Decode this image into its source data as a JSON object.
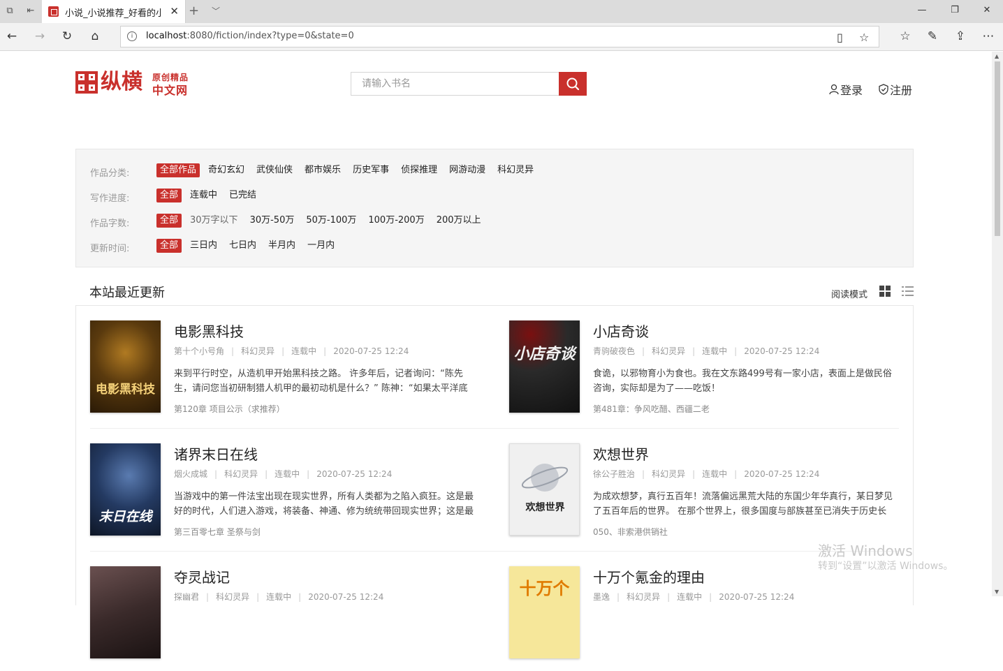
{
  "browser": {
    "tab_title": "小说_小说推荐_好看的小说",
    "url_host": "localhost",
    "url_rest": ":8080/fiction/index?type=0&state=0"
  },
  "site": {
    "logo_main": "纵横",
    "logo_sub1": "原创精品",
    "logo_sub2": "中文网",
    "search_placeholder": "请输入书名",
    "login": "登录",
    "register": "注册"
  },
  "filters": [
    {
      "label": "作品分类:",
      "options": [
        "全部作品",
        "奇幻玄幻",
        "武侠仙侠",
        "都市娱乐",
        "历史军事",
        "侦探推理",
        "网游动漫",
        "科幻灵异"
      ],
      "active": 0
    },
    {
      "label": "写作进度:",
      "options": [
        "全部",
        "连载中",
        "已完结"
      ],
      "active": 0
    },
    {
      "label": "作品字数:",
      "options": [
        "全部",
        "30万字以下",
        "30万-50万",
        "50万-100万",
        "100万-200万",
        "200万以上"
      ],
      "active": 0
    },
    {
      "label": "更新时间:",
      "options": [
        "全部",
        "三日内",
        "七日内",
        "半月内",
        "一月内"
      ],
      "active": 0
    }
  ],
  "section": {
    "title": "本站最近更新",
    "mode_label": "阅读模式"
  },
  "books": [
    {
      "name": "电影黑科技",
      "author": "第十个小号角",
      "category": "科幻灵异",
      "status": "连载中",
      "time": "2020-07-25 12:24",
      "desc": "来到平行时空，从造机甲开始黑科技之路。 许多年后，记者询问：“陈先生，请问您当初研制猎人机甲的最初动机是什么？” 陈神：“如果太平洋底下有一个怪兽...",
      "latest": "第120章 项目公示（求推荐）",
      "cover_text": "电影黑科技",
      "cover_bg": "#3a2608",
      "cover_fg": "#f0c35a"
    },
    {
      "name": "小店奇谈",
      "author": "青驹破夜色",
      "category": "科幻灵异",
      "status": "连载中",
      "time": "2020-07-25 12:24",
      "desc": "食诡，以邪物育小为食也。我在文东路499号有一家小店，表面上是做民俗咨询，实际却是为了——吃饭！",
      "latest": "第481章：争风吃醋、西疆二老",
      "cover_text": "小店奇谈",
      "cover_bg": "#1a1a1a",
      "cover_fg": "#f2f2f2"
    },
    {
      "name": "诸界末日在线",
      "author": "烟火成城",
      "category": "科幻灵异",
      "status": "连载中",
      "time": "2020-07-25 12:24",
      "desc": "当游戏中的第一件法宝出现在现实世界，所有人类都为之陷入疯狂。这是最好的时代，人们进入游戏，将装备、神通、修为统统带回现实世界；这是最坏的时代...",
      "latest": "第三百零七章 圣祭与剑",
      "cover_text": "末日在线",
      "cover_bg": "#14243d",
      "cover_fg": "#ffffff"
    },
    {
      "name": "欢想世界",
      "author": "徐公子胜治",
      "category": "科幻灵异",
      "status": "连载中",
      "time": "2020-07-25 12:24",
      "desc": "为成欢想梦，真行五百年！流落偏远黑荒大陆的东国少年华真行，某日梦见了五百年后的世界。 在那个世界上，很多国度与部族甚至已消失于历史长河...",
      "latest": "050、非索港供销社",
      "cover_text": "欢想世界",
      "cover_bg": "#eeeeee",
      "cover_fg": "#222222"
    },
    {
      "name": "夺灵战记",
      "author": "探幽君",
      "category": "科幻灵异",
      "status": "连载中",
      "time": "2020-07-25 12:24",
      "desc": "",
      "latest": "",
      "cover_text": "",
      "cover_bg": "#4a3a3a",
      "cover_fg": "#ffffff"
    },
    {
      "name": "十万个氪金的理由",
      "author": "墨逸",
      "category": "科幻灵异",
      "status": "连载中",
      "time": "2020-07-25 12:24",
      "desc": "",
      "latest": "",
      "cover_text": "十万个",
      "cover_bg": "#f6e79a",
      "cover_fg": "#d97a00"
    }
  ],
  "watermark": {
    "line1": "激活 Windows",
    "line2": "转到“设置”以激活 Windows。"
  }
}
